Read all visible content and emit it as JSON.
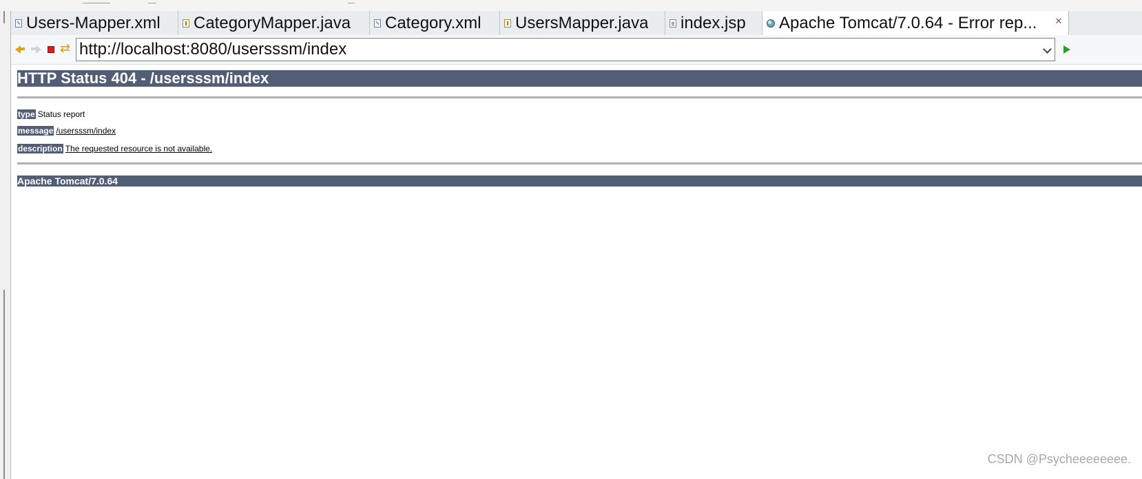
{
  "tabs": [
    {
      "label": "Users-Mapper.xml",
      "icon": "xml-file-icon"
    },
    {
      "label": "CategoryMapper.java",
      "icon": "java-file-icon"
    },
    {
      "label": "Category.xml",
      "icon": "xml-file-icon"
    },
    {
      "label": "UsersMapper.java",
      "icon": "java-file-icon"
    },
    {
      "label": "index.jsp",
      "icon": "jsp-file-icon"
    },
    {
      "label": "Apache Tomcat/7.0.64 - Error rep...",
      "icon": "globe-icon",
      "active": true,
      "close": "✕"
    }
  ],
  "toolbar": {
    "url": "http://localhost:8080/usersssm/index",
    "icons": [
      "back-arrow-icon",
      "forward-arrow-icon",
      "stop-icon",
      "refresh-icon",
      "go-icon"
    ]
  },
  "page": {
    "heading": "HTTP Status 404 - /usersssm/index",
    "type_label": "type",
    "type_value": "Status report",
    "message_label": "message",
    "message_value": "/usersssm/index",
    "description_label": "description",
    "description_value": "The requested resource is not available.",
    "footer": "Apache Tomcat/7.0.64"
  },
  "watermark": "CSDN @Psycheeeeeeee.",
  "colors": {
    "tomcat_bar": "#525d76",
    "stop_red": "#d61f1f",
    "nav_orange": "#e2a20f",
    "go_green": "#2f9b37"
  }
}
